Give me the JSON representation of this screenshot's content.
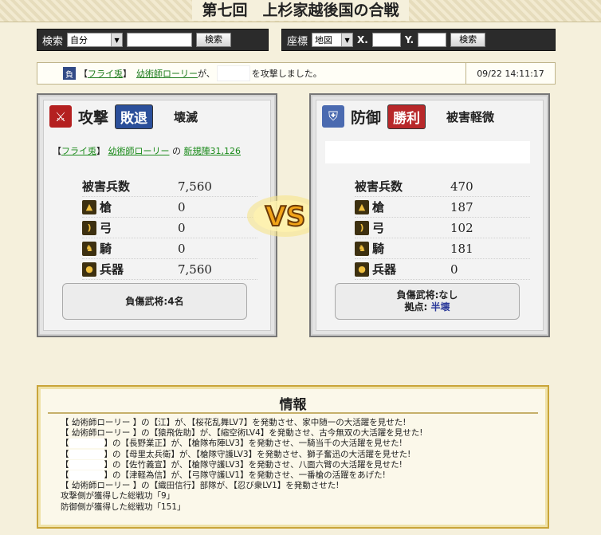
{
  "title": "第七回　上杉家越後国の合戦",
  "search_bar": {
    "label": "検索",
    "select_value": "自分",
    "input_value": "",
    "button": "検索"
  },
  "coord_bar": {
    "label": "座標",
    "select_value": "地図",
    "x_label": "X.",
    "y_label": "Y.",
    "x_value": "",
    "y_value": "",
    "button": "検索"
  },
  "report": {
    "badge": "負",
    "alliance": "フライ兎",
    "player": "幼術師ローリー",
    "middle": "が、",
    "end": "を攻撃しました。",
    "time": "09/22 14:11:17"
  },
  "attacker": {
    "side_label": "攻撃",
    "result": "敗退",
    "damage": "壊滅",
    "alliance": "フライ兎",
    "player": "幼術師ローリー",
    "of": "の",
    "target": "新規陣31,126",
    "casualties_label": "被害兵数",
    "casualties": "7,560",
    "units": [
      {
        "icon": "spear-icon",
        "label": "槍",
        "value": "0"
      },
      {
        "icon": "bow-icon",
        "label": "弓",
        "value": "0"
      },
      {
        "icon": "horse-icon",
        "label": "騎",
        "value": "0"
      },
      {
        "icon": "siege-icon",
        "label": "兵器",
        "value": "7,560"
      }
    ],
    "injured": "負傷武将:4名"
  },
  "defender": {
    "side_label": "防御",
    "result": "勝利",
    "damage": "被害軽微",
    "casualties_label": "被害兵数",
    "casualties": "470",
    "units": [
      {
        "icon": "spear-icon",
        "label": "槍",
        "value": "187"
      },
      {
        "icon": "bow-icon",
        "label": "弓",
        "value": "102"
      },
      {
        "icon": "horse-icon",
        "label": "騎",
        "value": "181"
      },
      {
        "icon": "siege-icon",
        "label": "兵器",
        "value": "0"
      }
    ],
    "injured": "負傷武将:なし",
    "base_label": "拠点:",
    "base_value": "半壊"
  },
  "info": {
    "title": "情報",
    "lines": [
      {
        "prefix": "【 幼術師ローリー 】の",
        "text": "【江】が、【桜花乱舞LV7】を発動させ、家中随一の大活躍を見せた!"
      },
      {
        "prefix": "【 幼術師ローリー 】の",
        "text": "【猿飛佐助】が、【縮空術LV4】を発動させ、古今無双の大活躍を見せた!"
      },
      {
        "prefix": "【",
        "blank": true,
        "text": "】の【長野業正】が、【槍隊布陣LV3】を発動させ、一騎当千の大活躍を見せた!"
      },
      {
        "prefix": "【",
        "blank": true,
        "text": "】の【母里太兵衛】が、【槍隊守護LV3】を発動させ、獅子奮迅の大活躍を見せた!"
      },
      {
        "prefix": "【",
        "blank": true,
        "text": "】の【佐竹義宣】が、【槍隊守護LV3】を発動させ、八面六臂の大活躍を見せた!"
      },
      {
        "prefix": "【",
        "blank": true,
        "text": "】の【津軽為信】が、【弓隊守護LV1】を発動させ、一番槍の活躍をあげた!"
      },
      {
        "prefix": "【 幼術師ローリー 】の",
        "text": "【織田信行】部隊が、【忍び衆LV1】を発動させた!"
      },
      {
        "prefix": "",
        "text": "攻撃側が獲得した総戦功「9」"
      },
      {
        "prefix": "",
        "text": "防御側が獲得した総戦功「151」"
      }
    ]
  },
  "colors": {
    "attack_badge": "#2b4f9a",
    "defense_badge": "#b8282a",
    "link": "#1a7a1a",
    "vs_fill": "#f2a418"
  }
}
